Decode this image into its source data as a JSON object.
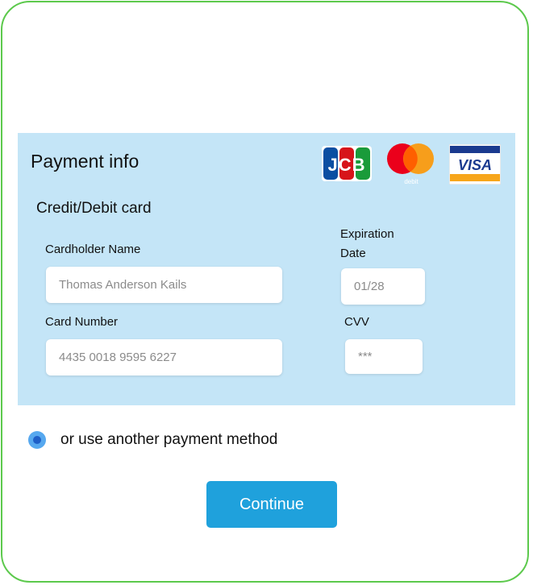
{
  "payment": {
    "title": "Payment info",
    "subtitle": "Credit/Debit card",
    "card_logos": [
      "jcb-logo",
      "mastercard-debit-logo",
      "visa-logo"
    ],
    "jcb_text": "JCB",
    "mastercard_text": "debit",
    "visa_text": "VISA",
    "cardholder_label": "Cardholder Name",
    "cardholder_value": "Thomas Anderson Kails",
    "card_number_label": "Card Number",
    "card_number_value": "4435 0018 9595 6227",
    "expiration_label_line1": "Expiration",
    "expiration_label_line2": "Date",
    "expiration_value": "01/28",
    "cvv_label": "CVV",
    "cvv_value": "***"
  },
  "alt_method": {
    "label": "or use another payment method",
    "selected": true
  },
  "actions": {
    "continue_label": "Continue"
  },
  "colors": {
    "frame_border": "#5cc94c",
    "panel_bg": "#c4e5f7",
    "button_bg": "#1fa1dc",
    "radio": "#56a8ef"
  }
}
